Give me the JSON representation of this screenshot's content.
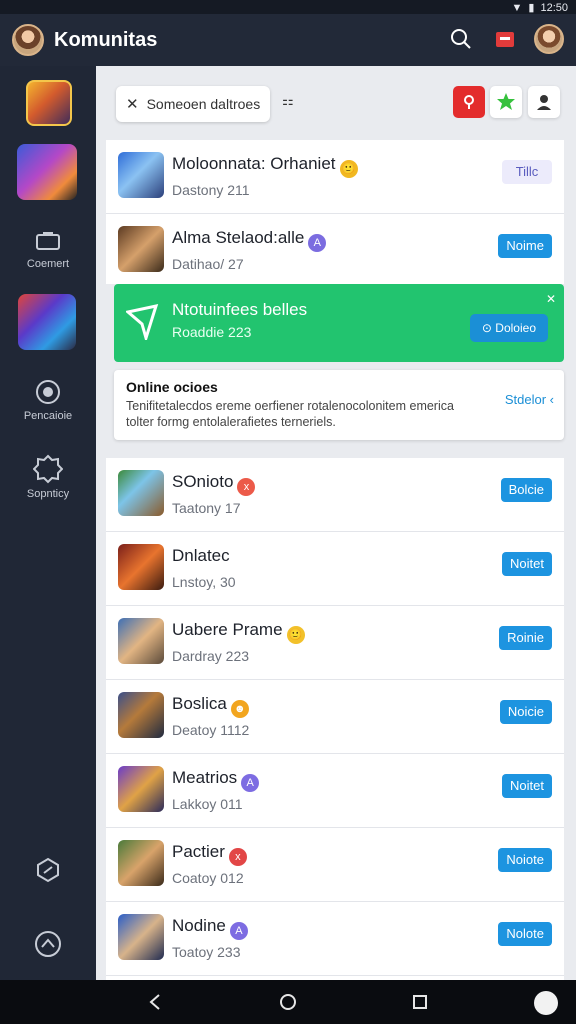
{
  "status_bar": {
    "time": "12:50"
  },
  "app_bar": {
    "title": "Komunitas"
  },
  "sidebar": {
    "items": [
      {
        "label": "Coemert",
        "icon": "chat-icon"
      },
      {
        "label": "Pencaioie",
        "icon": "circle-icon"
      },
      {
        "label": "Sopnticy",
        "icon": "gear-icon"
      }
    ]
  },
  "toolbar": {
    "search_chip": "Someoen daltroes",
    "mid_text": "⚏"
  },
  "list_top": [
    {
      "name": "Moloonnata: Orhaniet",
      "sub": "Dastony 211",
      "button": "Tillc",
      "emoji_color": "#f1b821",
      "emoji": "🙂",
      "button_style": "pale"
    },
    {
      "name": "Alma Stelaod:alle",
      "sub": "Datihao/ 27",
      "button": "Noime",
      "emoji_color": "#7b6ce0",
      "emoji": "A",
      "button_style": "primary"
    }
  ],
  "promo": {
    "title": "Ntotuinfees belles",
    "sub": "Roaddie 223",
    "button": "Doloieo"
  },
  "notice": {
    "title": "Online ocioes",
    "body": "Tenifitetalecdos ereme oerfiener rotalenocolonitem emerica tolter formg entolalerafietes terneriels.",
    "link": "Stdelor"
  },
  "list_main": [
    {
      "name": "SOnioto",
      "sub": "Taatony 17",
      "button": "Bolcie",
      "emoji_color": "#ec5a49",
      "emoji": "x"
    },
    {
      "name": "Dnlatec",
      "sub": "Lnstoy, 30",
      "button": "Noitet",
      "emoji_color": "",
      "emoji": ""
    },
    {
      "name": "Uabere Prame",
      "sub": "Dardray 223",
      "button": "Roinie",
      "emoji_color": "#f2c12a",
      "emoji": "🙂"
    },
    {
      "name": "Boslica",
      "sub": "Deatoy 1112",
      "button": "Noicie",
      "emoji_color": "#f2a51e",
      "emoji": "☻"
    },
    {
      "name": "Meatrios",
      "sub": "Lakkoy 011",
      "button": "Noitet",
      "emoji_color": "#7d6ce2",
      "emoji": "A"
    },
    {
      "name": "Pactier",
      "sub": "Coatoy 012",
      "button": "Noiote",
      "emoji_color": "#e24646",
      "emoji": "x"
    },
    {
      "name": "Nodine",
      "sub": "Toatoy 233",
      "button": "Nolote",
      "emoji_color": "#7d6ce2",
      "emoji": "A"
    }
  ],
  "colors": {
    "accent": "#1d94e0",
    "promo": "#22c46f",
    "sidebar": "#202736"
  }
}
